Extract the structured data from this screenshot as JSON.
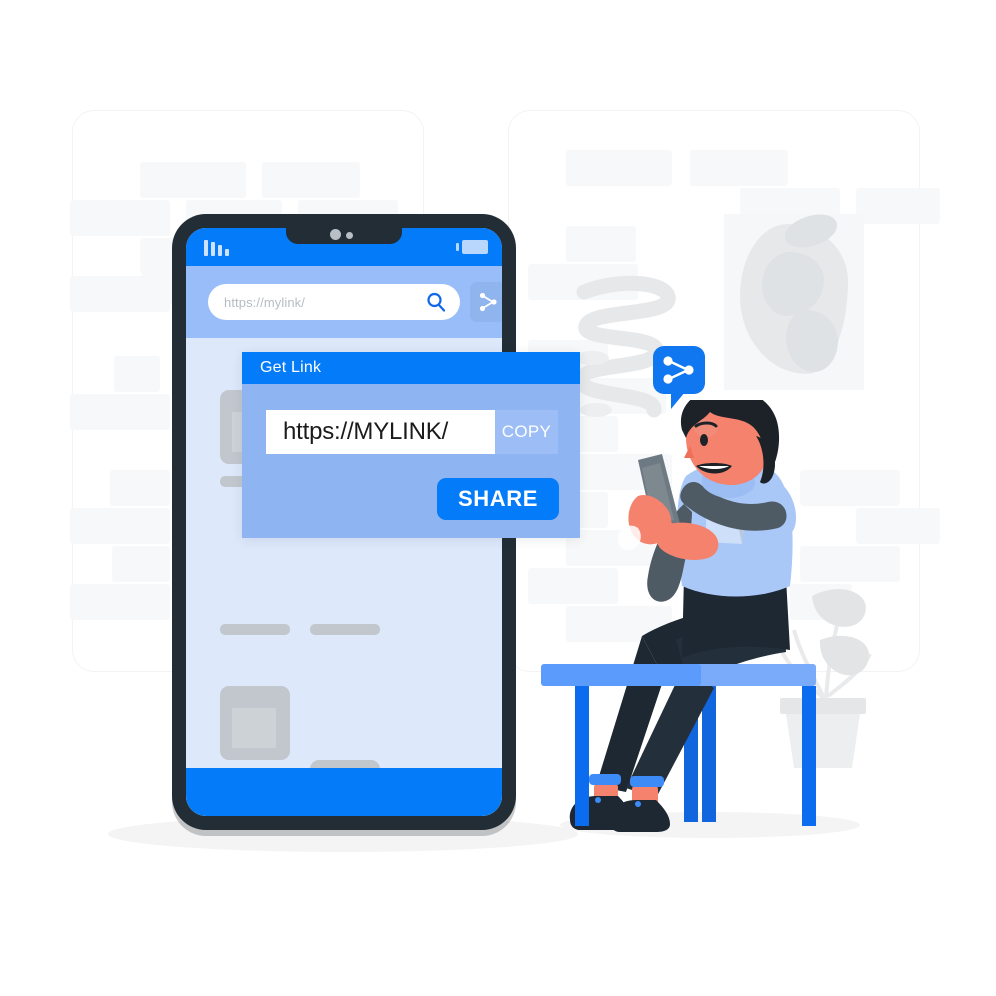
{
  "illustration": {
    "title": "Share link concept illustration",
    "description": "Person sitting on a bench using a phone next to a large smartphone showing a Get Link share dialog"
  },
  "colors": {
    "primary_blue": "#047bf8",
    "mid_blue": "#8fb4f2",
    "light_blue_screen": "#dde8fa",
    "search_band": "#99bdf9",
    "phone_frame": "#222d35",
    "bench_blue": "#0b6cf0",
    "bench_top": "#7aabfb",
    "skin": "#f4826d",
    "hair": "#1c2228",
    "shirt": "#a9c8f8",
    "sleeve": "#4e5a64",
    "pants": "#1d2833",
    "placeholder_grey": "#c2c7cd",
    "background": "#ffffff"
  },
  "phone": {
    "status_bar": {
      "signal_icon": "signal-bars-icon",
      "battery_icon": "battery-icon",
      "camera_icon": "front-camera-dot",
      "sensor_icon": "proximity-sensor-dot"
    },
    "search": {
      "placeholder": "https://mylink/",
      "search_icon": "search-icon",
      "share_icon": "share-network-icon"
    },
    "content": {
      "card_icon": "image-placeholder-icon",
      "cards": [
        {
          "name": "photo-card-1"
        },
        {
          "name": "photo-card-2"
        },
        {
          "name": "photo-card-3"
        },
        {
          "name": "photo-card-4"
        }
      ],
      "text_lines": [
        {
          "name": "text-line-1"
        },
        {
          "name": "text-line-2"
        },
        {
          "name": "text-line-3"
        },
        {
          "name": "text-line-4"
        }
      ]
    },
    "bottom_bar_label": ""
  },
  "dialog": {
    "title": "Get Link",
    "url_value": "https://MYLINK/",
    "copy_label": "COPY",
    "share_label": "SHARE"
  },
  "bubble": {
    "icon": "share-network-icon",
    "label": ""
  },
  "scene": {
    "wall_art_name": "abstract-wall-art",
    "plant_name": "potted-plant",
    "squiggle_name": "decorative-squiggle",
    "bench_name": "bench",
    "person_name": "person-using-phone",
    "handheld_phone_name": "handheld-phone"
  }
}
